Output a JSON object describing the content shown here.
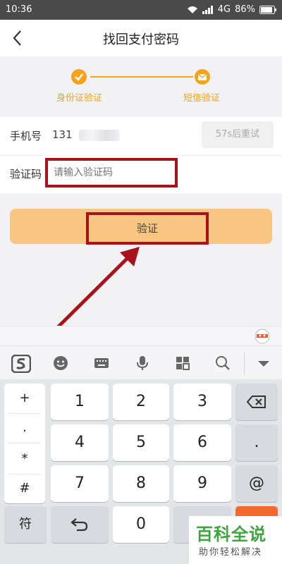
{
  "status_bar": {
    "time": "10:36",
    "network": "4G",
    "battery": "86%"
  },
  "header": {
    "title": "找回支付密码"
  },
  "steps": [
    {
      "label": "身份证验证"
    },
    {
      "label": "短信验证"
    }
  ],
  "form": {
    "phone_label": "手机号",
    "phone_prefix": "131",
    "retry_label": "57s后重试",
    "code_label": "验证码",
    "code_placeholder": "请输入验证码"
  },
  "verify_button": {
    "label": "验证"
  },
  "keyboard": {
    "side_keys": [
      "+",
      ".",
      "*",
      "#"
    ],
    "symbol_key": "符",
    "number_rows": [
      [
        "1",
        "2",
        "3"
      ],
      [
        "4",
        "5",
        "6"
      ],
      [
        "7",
        "8",
        "9"
      ]
    ],
    "zero": "0",
    "right_keys": [
      ".",
      "@"
    ]
  },
  "watermark": {
    "title": "百科全说",
    "subtitle": "助你轻松解决"
  },
  "colors": {
    "accent": "#f6a21a",
    "button": "#f8c682",
    "annotation": "#a9121a"
  }
}
